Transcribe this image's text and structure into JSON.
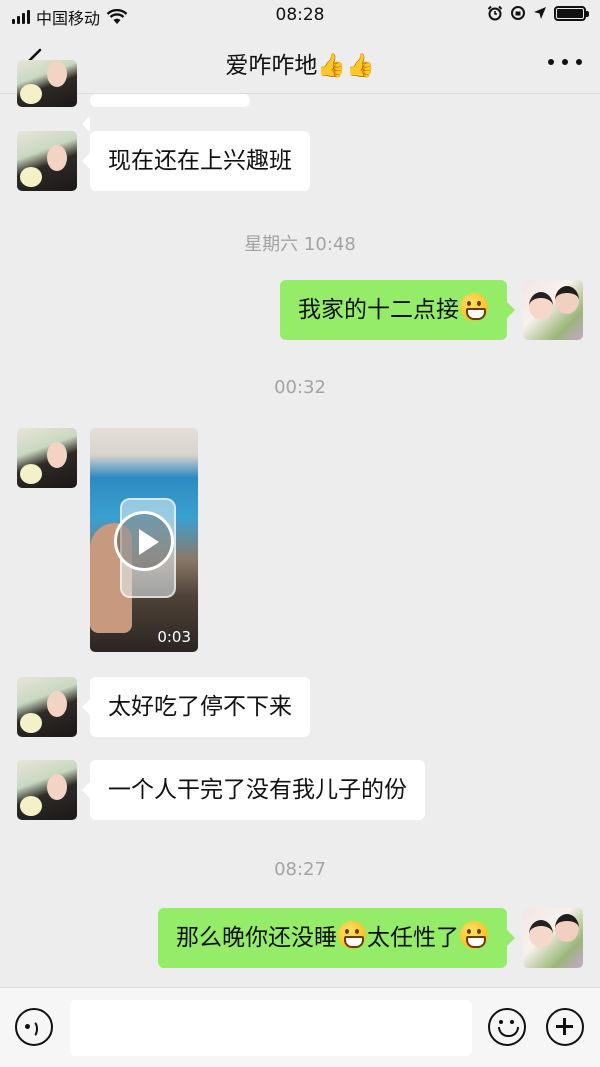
{
  "status_bar": {
    "carrier": "中国移动",
    "time": "08:28"
  },
  "chat": {
    "title": "爱咋咋地👍👍"
  },
  "messages": [
    {
      "type": "text",
      "sender": "other",
      "text": "现在还在上兴趣班"
    },
    {
      "type": "timestamp",
      "text": "星期六 10:48"
    },
    {
      "type": "text",
      "sender": "me",
      "text": "我家的十二点接",
      "emojis": [
        "grin-emoji"
      ]
    },
    {
      "type": "timestamp",
      "text": "00:32"
    },
    {
      "type": "video",
      "sender": "other",
      "duration": "0:03"
    },
    {
      "type": "text",
      "sender": "other",
      "text": "太好吃了停不下来"
    },
    {
      "type": "text",
      "sender": "other",
      "text": "一个人干完了没有我儿子的份"
    },
    {
      "type": "timestamp",
      "text": "08:27"
    },
    {
      "type": "text",
      "sender": "me",
      "parts": [
        "那么晚你还没睡",
        "太任性了"
      ],
      "emojis": [
        "grin-emoji",
        "grin-emoji"
      ]
    }
  ],
  "input_bar": {
    "placeholder": "",
    "icons": [
      "voice-icon",
      "emoji-icon",
      "plus-icon"
    ]
  },
  "colors": {
    "background": "#ededed",
    "incoming_bubble": "#ffffff",
    "outgoing_bubble": "#95ec69",
    "timestamp_text": "#a3a3a3"
  }
}
